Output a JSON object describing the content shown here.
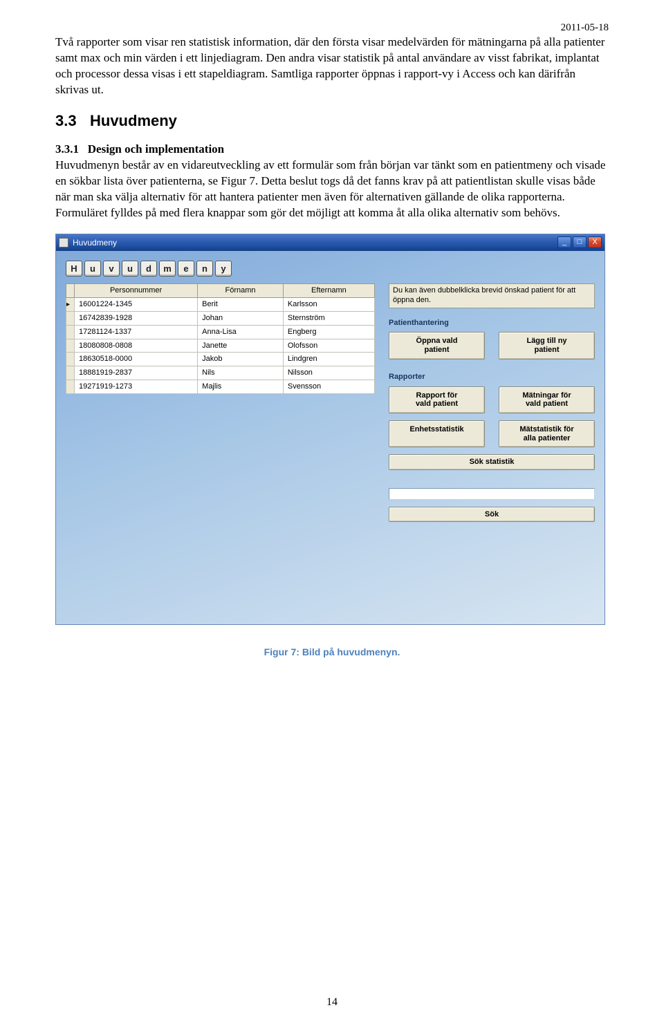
{
  "page": {
    "date": "2011-05-18",
    "page_number": "14"
  },
  "text": {
    "p1": "Två rapporter som visar ren statistisk information, där den första visar medelvärden för mätningarna på alla patienter samt max och min värden i ett linjediagram. Den andra visar statistik på antal användare av visst fabrikat, implantat och processor dessa visas i ett stapeldiagram. Samtliga rapporter öppnas i rapport-vy i Access och kan därifrån skrivas ut.",
    "h3_num": "3.3",
    "h3_title": "Huvudmeny",
    "sub_num": "3.3.1",
    "sub_title": "Design och implementation",
    "p2": "Huvudmenyn består av en vidareutveckling av ett formulär som från början var tänkt som en patientmeny och visade en sökbar lista över patienterna, se Figur 7. Detta beslut togs då det fanns krav på att patientlistan skulle visas både när man ska välja alternativ för att hantera patienter men även för alternativen gällande de olika rapporterna. Formuläret fylldes på med flera knappar som gör det möjligt att komma åt alla olika alternativ som behövs.",
    "caption": "Figur 7: Bild på huvudmenyn."
  },
  "window": {
    "title": "Huvudmeny",
    "logo_letters": [
      "H",
      "u",
      "v",
      "u",
      "d",
      "m",
      "e",
      "n",
      "y"
    ],
    "hint": "Du kan även dubbelklicka brevid önskad patient för att öppna den.",
    "group_patients": "Patienthantering",
    "group_reports": "Rapporter",
    "btn_open": "Öppna vald\npatient",
    "btn_add": "Lägg till ny\npatient",
    "btn_report": "Rapport för\nvald patient",
    "btn_meas": "Mätningar för\nvald patient",
    "btn_unit": "Enhetsstatistik",
    "btn_all": "Mätstatistik för\nalla patienter",
    "btn_sokstat": "Sök statistik",
    "btn_sok": "Sök",
    "table": {
      "headers": [
        "Personnummer",
        "Förnamn",
        "Efternamn"
      ],
      "rows": [
        [
          "16001224-1345",
          "Berit",
          "Karlsson"
        ],
        [
          "16742839-1928",
          "Johan",
          "Sternström"
        ],
        [
          "17281124-1337",
          "Anna-Lisa",
          "Engberg"
        ],
        [
          "18080808-0808",
          "Janette",
          "Olofsson"
        ],
        [
          "18630518-0000",
          "Jakob",
          "Lindgren"
        ],
        [
          "18881919-2837",
          "Nils",
          "Nilsson"
        ],
        [
          "19271919-1273",
          "Majlis",
          "Svensson"
        ]
      ]
    }
  }
}
